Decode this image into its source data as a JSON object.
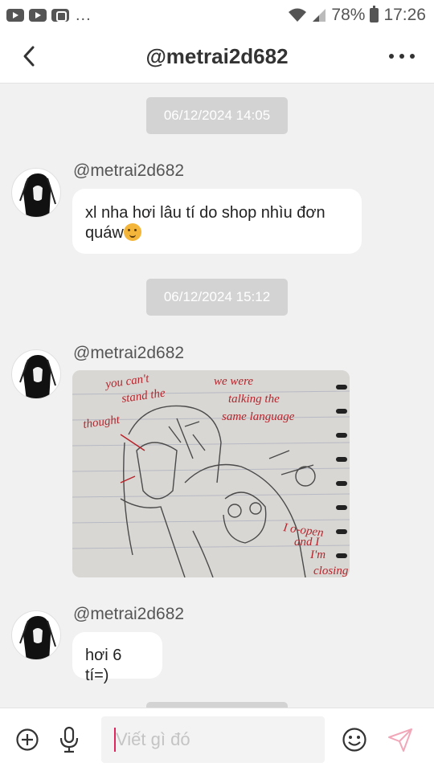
{
  "status_bar": {
    "dots": "...",
    "battery": "78%",
    "time": "17:26"
  },
  "header": {
    "title": "@metrai2d682"
  },
  "messages": [
    {
      "date": "06/12/2024 14:05",
      "sender": "@metrai2d682",
      "text": "xl nha hơi lâu tí do shop nhìu đơn quáw"
    },
    {
      "date": "06/12/2024 15:12",
      "sender": "@metrai2d682",
      "image_texts": [
        "you can't stand the thought",
        "we were talking the same language",
        "I o-open and I'm closing"
      ]
    },
    {
      "sender": "@metrai2d682",
      "text": "hơi 6 tí=)"
    }
  ],
  "composer": {
    "placeholder": "Viết gì đó"
  },
  "colors": {
    "accent": "#e0245e",
    "date_chip": "#d3d3d3",
    "background": "#f1f1f2"
  }
}
